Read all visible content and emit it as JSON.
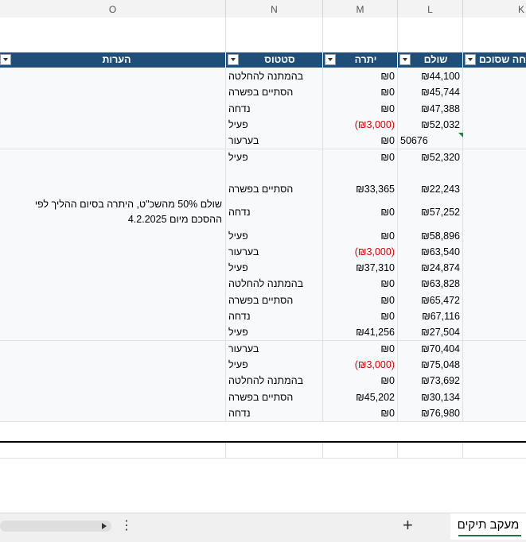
{
  "column_letters": [
    "O",
    "N",
    "M",
    "L",
    "K"
  ],
  "table_headers": {
    "notes": "הערות",
    "status": "סטטוס",
    "balance": "יתרה",
    "paid": "שולם",
    "agreed": "חה שסוכם"
  },
  "rows": [
    {
      "status": "בהמתנה להחלטה",
      "balance": "₪0",
      "paid": "₪44,100",
      "notes": ""
    },
    {
      "status": "הסתיים בפשרה",
      "balance": "₪0",
      "paid": "₪45,744",
      "notes": ""
    },
    {
      "status": "נדחה",
      "balance": "₪0",
      "paid": "₪47,388",
      "notes": ""
    },
    {
      "status": "פעיל",
      "balance": "(₪3,000)",
      "paid": "₪52,032",
      "notes": "",
      "negative": true
    },
    {
      "status": "בערעור",
      "balance": "₪0",
      "paid": "50676",
      "notes": "",
      "flag": true
    },
    {
      "status": "פעיל",
      "balance": "₪0",
      "paid": "₪52,320",
      "notes": ""
    },
    {
      "status": "",
      "balance": "",
      "paid": "",
      "notes": ""
    },
    {
      "status": "הסתיים בפשרה",
      "balance": "₪33,365",
      "paid": "₪22,243",
      "notes": ""
    },
    {
      "status": "נדחה",
      "balance": "₪0",
      "paid": "₪57,252",
      "notes": "שולם 50% מהשכ\"ט, היתרה בסיום ההליך לפי ההסכם מיום 4.2.2025",
      "tall": true
    },
    {
      "status": "פעיל",
      "balance": "₪0",
      "paid": "₪58,896",
      "notes": ""
    },
    {
      "status": "בערעור",
      "balance": "(₪3,000)",
      "paid": "₪63,540",
      "notes": "",
      "negative": true
    },
    {
      "status": "פעיל",
      "balance": "₪37,310",
      "paid": "₪24,874",
      "notes": ""
    },
    {
      "status": "בהמתנה להחלטה",
      "balance": "₪0",
      "paid": "₪63,828",
      "notes": ""
    },
    {
      "status": "הסתיים בפשרה",
      "balance": "₪0",
      "paid": "₪65,472",
      "notes": ""
    },
    {
      "status": "נדחה",
      "balance": "₪0",
      "paid": "₪67,116",
      "notes": ""
    },
    {
      "status": "פעיל",
      "balance": "₪41,256",
      "paid": "₪27,504",
      "notes": ""
    },
    {
      "status": "בערעור",
      "balance": "₪0",
      "paid": "₪70,404",
      "notes": ""
    },
    {
      "status": "פעיל",
      "balance": "(₪3,000)",
      "paid": "₪75,048",
      "notes": "",
      "negative": true
    },
    {
      "status": "בהמתנה להחלטה",
      "balance": "₪0",
      "paid": "₪73,692",
      "notes": ""
    },
    {
      "status": "הסתיים בפשרה",
      "balance": "₪45,202",
      "paid": "₪30,134",
      "notes": ""
    },
    {
      "status": "נדחה",
      "balance": "₪0",
      "paid": "₪76,980",
      "notes": ""
    }
  ],
  "bottom_bar": {
    "add_sheet": "+",
    "more_options": "⋮",
    "sheet_tab": "מעקב תיקים"
  }
}
